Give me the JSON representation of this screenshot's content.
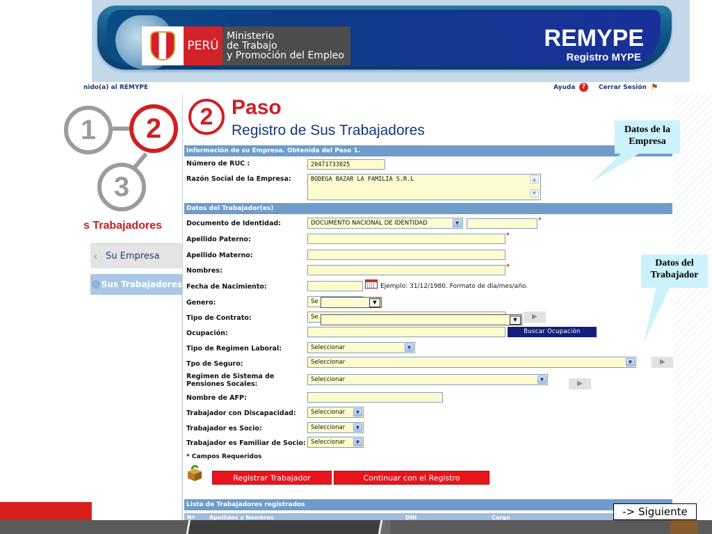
{
  "header": {
    "country": "PERÚ",
    "ministry_line1": "Ministerio",
    "ministry_line2": "de Trabajo",
    "ministry_line3": "y Promoción del Empleo",
    "app_name": "REMYPE",
    "app_subtitle": "Registro MYPE"
  },
  "topbar": {
    "welcome": "nido(a) al REMYPE",
    "help": "Ayuda",
    "logout": "Cerrar Sesión"
  },
  "steps": {
    "step1": "1",
    "step2": "2",
    "step3": "3",
    "current_title": "s Trabajadores",
    "nav": [
      {
        "label": "Su Empresa",
        "icon": "arrow-icon"
      },
      {
        "label": "Sus Trabajadores",
        "icon": "circle-icon"
      }
    ]
  },
  "page": {
    "step_number": "2",
    "step_word": "Paso",
    "title": "Registro de Sus Trabajadores"
  },
  "empresa": {
    "section_title": "Información de su Empresa. Obtenida del Paso 1.",
    "ruc_label": "Número de RUC :",
    "ruc_value": "20471733025",
    "razon_label": "Razón Social de la Empresa:",
    "razon_value": "BODEGA BAZAR LA FAMILIA S.R.L"
  },
  "trabajador": {
    "section_title": "Datos del Trabajador(es)",
    "doc_label": "Documento de Identidad:",
    "doc_value": "DOCUMENTO NACIONAL DE IDENTIDAD",
    "ap_paterno_label": "Apellido Paterno:",
    "ap_materno_label": "Apellido Materno:",
    "nombres_label": "Nombres:",
    "fecha_label": "Fecha de Nacimiento:",
    "fecha_hint": "Ejemplo: 31/12/1980. Formato de día/mes/año.",
    "genero_label": "Genero:",
    "genero_value": "Se",
    "contrato_label": "Tipo de Contrato:",
    "contrato_value": "Se",
    "ocupacion_label": "Ocupación:",
    "buscar_button": "Buscar Ocupación",
    "regimen_label": "Tipo de Regimen Laboral:",
    "regimen_value": "Seleccionar",
    "seguro_label": "Tpo de Seguro:",
    "seguro_value": "Seleccionar",
    "pensiones_label_1": "Regimen de Sistema de",
    "pensiones_label_2": "Pensiones Socales:",
    "pensiones_value": "Seleccionar",
    "afp_label": "Nombre de AFP:",
    "discapacidad_label": "Trabajador con Discapacidad:",
    "discapacidad_value": "Seleccionar",
    "socio_label": "Trabajador es Socio:",
    "socio_value": "Seleccionar",
    "familiar_label": "Trabajador es Familiar de Socio:",
    "familiar_value": "Seleccionar",
    "required_note": "* Campos Requeridos",
    "required_mark": "*",
    "registrar_button": "Registrar Trabajador",
    "continuar_button": "Continuar con el Registro"
  },
  "lista": {
    "section_title": "Lista de Trabajadores registrados",
    "columns": [
      "Nº",
      "Apellidos y Nombres",
      "DNI",
      "Cargo"
    ]
  },
  "callouts": {
    "empresa_line1": "Datos de la",
    "empresa_line2": "Empresa",
    "trabajador_line1": "Datos del",
    "trabajador_line2": "Trabajador"
  },
  "siguiente": "-> Siguiente",
  "colors": {
    "accent_red": "#d01f23",
    "navy": "#12377a",
    "section_bar": "#6e9ccb",
    "field_bg": "#fefccf"
  }
}
